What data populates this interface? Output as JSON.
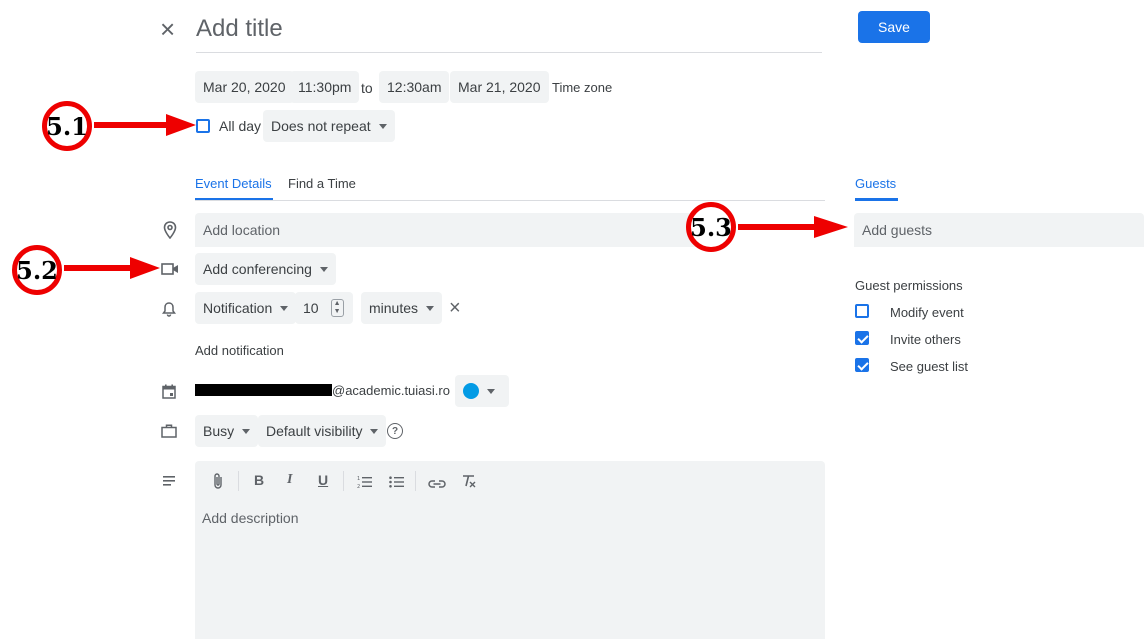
{
  "header": {
    "close_glyph": "×",
    "title_placeholder": "Add title",
    "save_label": "Save"
  },
  "datetime": {
    "start_date": "Mar 20, 2020",
    "start_time": "11:30pm",
    "to": "to",
    "end_time": "12:30am",
    "end_date": "Mar 21, 2020",
    "timezone": "Time zone"
  },
  "allday": {
    "label": "All day",
    "checked": false,
    "repeat": "Does not repeat"
  },
  "tabs": {
    "details": "Event Details",
    "find_time": "Find a Time"
  },
  "guests": {
    "tab": "Guests",
    "placeholder": "Add guests",
    "permissions_title": "Guest permissions",
    "permissions": [
      {
        "label": "Modify event",
        "checked": false
      },
      {
        "label": "Invite others",
        "checked": true
      },
      {
        "label": "See guest list",
        "checked": true
      }
    ]
  },
  "location": {
    "placeholder": "Add location"
  },
  "conferencing": {
    "label": "Add conferencing"
  },
  "notification": {
    "type": "Notification",
    "value": "10",
    "unit": "minutes",
    "remove_glyph": "×"
  },
  "add_notification": "Add notification",
  "calendar": {
    "owner_suffix": "@academic.tuiasi.ro",
    "color": "#039be5"
  },
  "availability": {
    "status": "Busy",
    "visibility": "Default visibility",
    "help_glyph": "?"
  },
  "description": {
    "placeholder": "Add description",
    "toolbar": {
      "bold": "B",
      "italic": "I",
      "underline": "U"
    }
  },
  "annotations": [
    {
      "label": "5.1"
    },
    {
      "label": "5.2"
    },
    {
      "label": "5.3"
    }
  ],
  "colors": {
    "accent": "#1a73e8",
    "annotation": "#ee0000",
    "field_bg": "#f1f3f4"
  }
}
